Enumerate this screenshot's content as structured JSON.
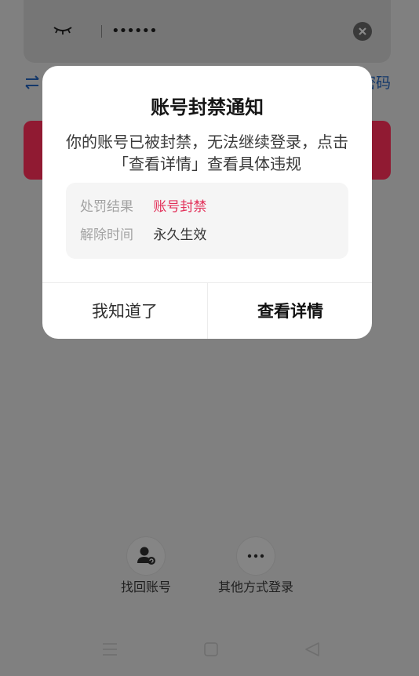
{
  "login": {
    "password_value": "••••••",
    "switch_text": "密码",
    "eye_icon": "eye-closed-icon",
    "clear_icon": "clear-icon"
  },
  "modal": {
    "title": "账号封禁通知",
    "message": "你的账号已被封禁，无法继续登录，点击「查看详情」查看具体违规",
    "rows": [
      {
        "label": "处罚结果",
        "value": "账号封禁",
        "color": "#e2315a"
      },
      {
        "label": "解除时间",
        "value": "永久生效",
        "color": "#333333"
      }
    ],
    "dismiss_label": "我知道了",
    "details_label": "查看详情"
  },
  "bottom_options": [
    {
      "label": "找回账号",
      "icon": "user-recover-icon"
    },
    {
      "label": "其他方式登录",
      "icon": "more-icon"
    }
  ],
  "nav": {
    "icons": [
      "menu-icon",
      "home-icon",
      "back-icon"
    ]
  },
  "colors": {
    "overlay": "#808080",
    "login_button": "#901a32",
    "penalty_text": "#e2315a"
  }
}
